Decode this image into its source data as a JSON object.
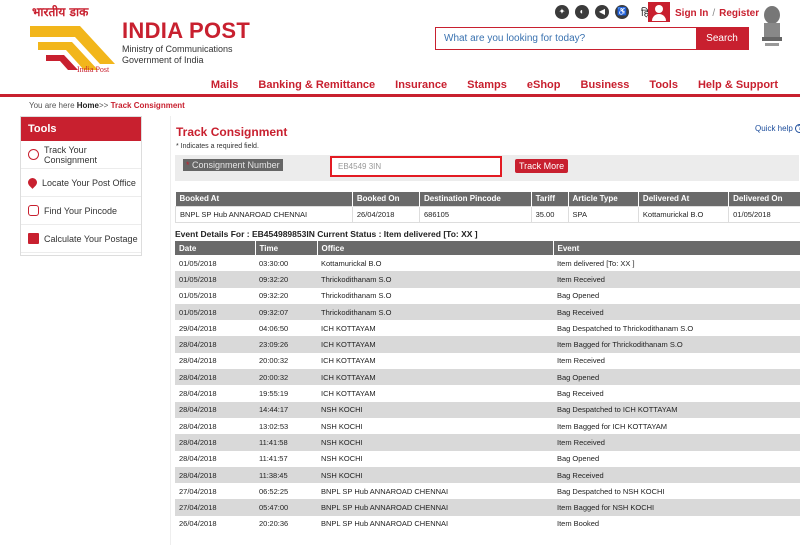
{
  "header": {
    "logo_hindi": "भारतीय डाक",
    "logo_caption": "India Post",
    "brand": "INDIA POST",
    "ministry_line1": "Ministry of Communications",
    "ministry_line2": "Government of India",
    "lang_hindi": "हिन्दी",
    "sign_in": "Sign In",
    "register": "Register",
    "search_placeholder": "What are you looking for today?",
    "search_button": "Search"
  },
  "nav": [
    "Mails",
    "Banking & Remittance",
    "Insurance",
    "Stamps",
    "eShop",
    "Business",
    "Tools",
    "Help & Support"
  ],
  "breadcrumb": {
    "prefix": "You are here",
    "home": "Home",
    "sep": ">>",
    "current": "Track Consignment"
  },
  "sidebar": {
    "title": "Tools",
    "items": [
      {
        "label": "Track Your Consignment",
        "icon": "target-icon"
      },
      {
        "label": "Locate Your Post Office",
        "icon": "map-pin-icon"
      },
      {
        "label": "Find Your Pincode",
        "icon": "binoculars-icon"
      },
      {
        "label": "Calculate Your Postage",
        "icon": "calculator-icon"
      }
    ]
  },
  "main": {
    "title": "Track Consignment",
    "quick_help": "Quick help",
    "required_note": "* Indicates a required field.",
    "field_label": "Consignment Number",
    "field_value": "EB4549          3IN",
    "track_button": "Track More"
  },
  "summary": {
    "headers": [
      "Booked At",
      "Booked On",
      "Destination Pincode",
      "Tariff",
      "Article Type",
      "Delivered At",
      "Delivered On"
    ],
    "row": [
      "BNPL SP Hub ANNAROAD CHENNAI",
      "26/04/2018",
      "686105",
      "35.00",
      "SPA",
      "Kottamurickal B.O",
      "01/05/2018"
    ]
  },
  "event_heading": "Event Details For : EB454989853IN    Current Status : Item delivered [To: XX ]",
  "events": {
    "headers": [
      "Date",
      "Time",
      "Office",
      "Event"
    ],
    "rows": [
      [
        "01/05/2018",
        "03:30:00",
        "Kottamurickal B.O",
        "Item delivered [To: XX ]"
      ],
      [
        "01/05/2018",
        "09:32:20",
        "Thrickodithanam S.O",
        "Item Received"
      ],
      [
        "01/05/2018",
        "09:32:20",
        "Thrickodithanam S.O",
        "Bag Opened"
      ],
      [
        "01/05/2018",
        "09:32:07",
        "Thrickodithanam S.O",
        "Bag Received"
      ],
      [
        "29/04/2018",
        "04:06:50",
        "ICH KOTTAYAM",
        "Bag Despatched to Thrickodithanam S.O"
      ],
      [
        "28/04/2018",
        "23:09:26",
        "ICH KOTTAYAM",
        "Item Bagged for Thrickodithanam S.O"
      ],
      [
        "28/04/2018",
        "20:00:32",
        "ICH KOTTAYAM",
        "Item Received"
      ],
      [
        "28/04/2018",
        "20:00:32",
        "ICH KOTTAYAM",
        "Bag Opened"
      ],
      [
        "28/04/2018",
        "19:55:19",
        "ICH KOTTAYAM",
        "Bag Received"
      ],
      [
        "28/04/2018",
        "14:44:17",
        "NSH KOCHI",
        "Bag Despatched to ICH KOTTAYAM"
      ],
      [
        "28/04/2018",
        "13:02:53",
        "NSH KOCHI",
        "Item Bagged for ICH KOTTAYAM"
      ],
      [
        "28/04/2018",
        "11:41:58",
        "NSH KOCHI",
        "Item Received"
      ],
      [
        "28/04/2018",
        "11:41:57",
        "NSH KOCHI",
        "Bag Opened"
      ],
      [
        "28/04/2018",
        "11:38:45",
        "NSH KOCHI",
        "Bag Received"
      ],
      [
        "27/04/2018",
        "06:52:25",
        "BNPL SP Hub ANNAROAD CHENNAI",
        "Bag Despatched to NSH KOCHI"
      ],
      [
        "27/04/2018",
        "05:47:00",
        "BNPL SP Hub ANNAROAD CHENNAI",
        "Item Bagged for NSH KOCHI"
      ],
      [
        "26/04/2018",
        "20:20:36",
        "BNPL SP Hub ANNAROAD CHENNAI",
        "Item Booked"
      ]
    ]
  },
  "colors": {
    "brand_red": "#c8202f",
    "header_gray": "#6a6a6a"
  }
}
